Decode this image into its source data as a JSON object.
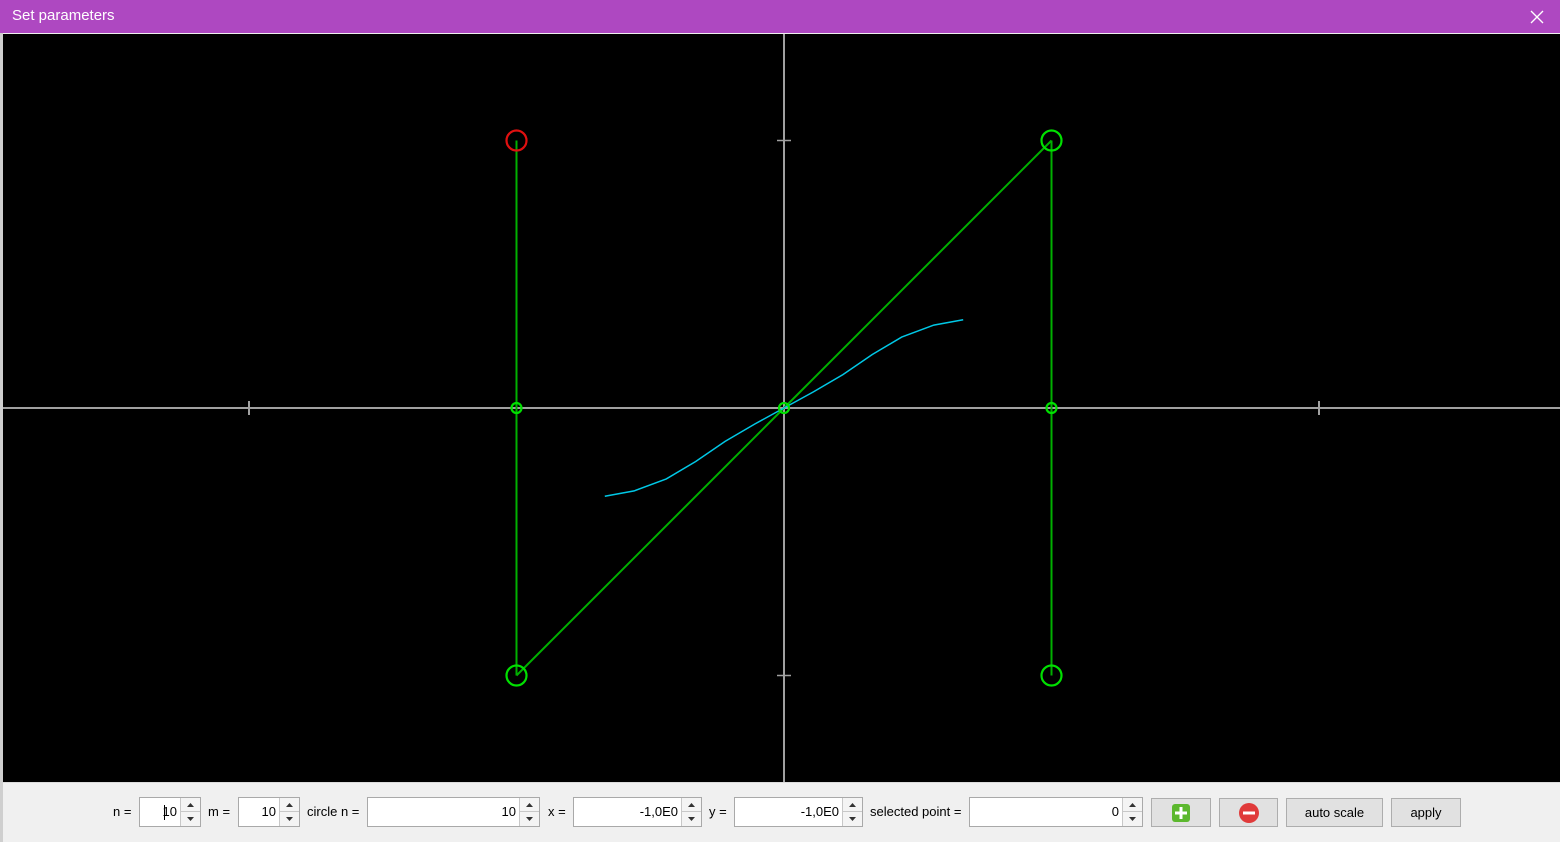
{
  "window": {
    "title": "Set parameters",
    "titlebar_color": "#ae48c1",
    "close_icon": "close-icon"
  },
  "canvas": {
    "background": "#000000",
    "axes_color": "#a0a0a0",
    "control_points": [
      {
        "x": -1,
        "y": 1,
        "color": "#e01010",
        "size": "large"
      },
      {
        "x": -1,
        "y": 0,
        "color": "#00e000",
        "size": "small"
      },
      {
        "x": -1,
        "y": -1,
        "color": "#00e000",
        "size": "large"
      },
      {
        "x": 0,
        "y": 0,
        "color": "#00e000",
        "size": "small"
      },
      {
        "x": 1,
        "y": 1,
        "color": "#00e000",
        "size": "large"
      },
      {
        "x": 1,
        "y": 0,
        "color": "#00e000",
        "size": "small"
      },
      {
        "x": 1,
        "y": -1,
        "color": "#00e000",
        "size": "large"
      }
    ],
    "polyline_color": "#00b000",
    "curve_color": "#00c8e6",
    "curve_points": [
      [
        -0.67,
        -0.33
      ],
      [
        -0.56,
        -0.31
      ],
      [
        -0.44,
        -0.265
      ],
      [
        -0.33,
        -0.2
      ],
      [
        -0.22,
        -0.125
      ],
      [
        -0.11,
        -0.06
      ],
      [
        0,
        0
      ],
      [
        0.11,
        0.06
      ],
      [
        0.22,
        0.125
      ],
      [
        0.33,
        0.2
      ],
      [
        0.44,
        0.265
      ],
      [
        0.56,
        0.31
      ],
      [
        0.67,
        0.33
      ]
    ]
  },
  "toolbar": {
    "n_label": "n =",
    "n_value": "10",
    "m_label": "m =",
    "m_value": "10",
    "circle_n_label": "circle n =",
    "circle_n_value": "10",
    "x_label": "x =",
    "x_value": "-1,0E0",
    "y_label": "y =",
    "y_value": "-1,0E0",
    "selected_point_label": "selected point =",
    "selected_point_value": "0",
    "add_icon": "plus-icon",
    "add_color": "#5cb82e",
    "remove_icon": "minus-icon",
    "remove_color": "#e03a3a",
    "auto_scale_label": "auto scale",
    "apply_label": "apply"
  }
}
